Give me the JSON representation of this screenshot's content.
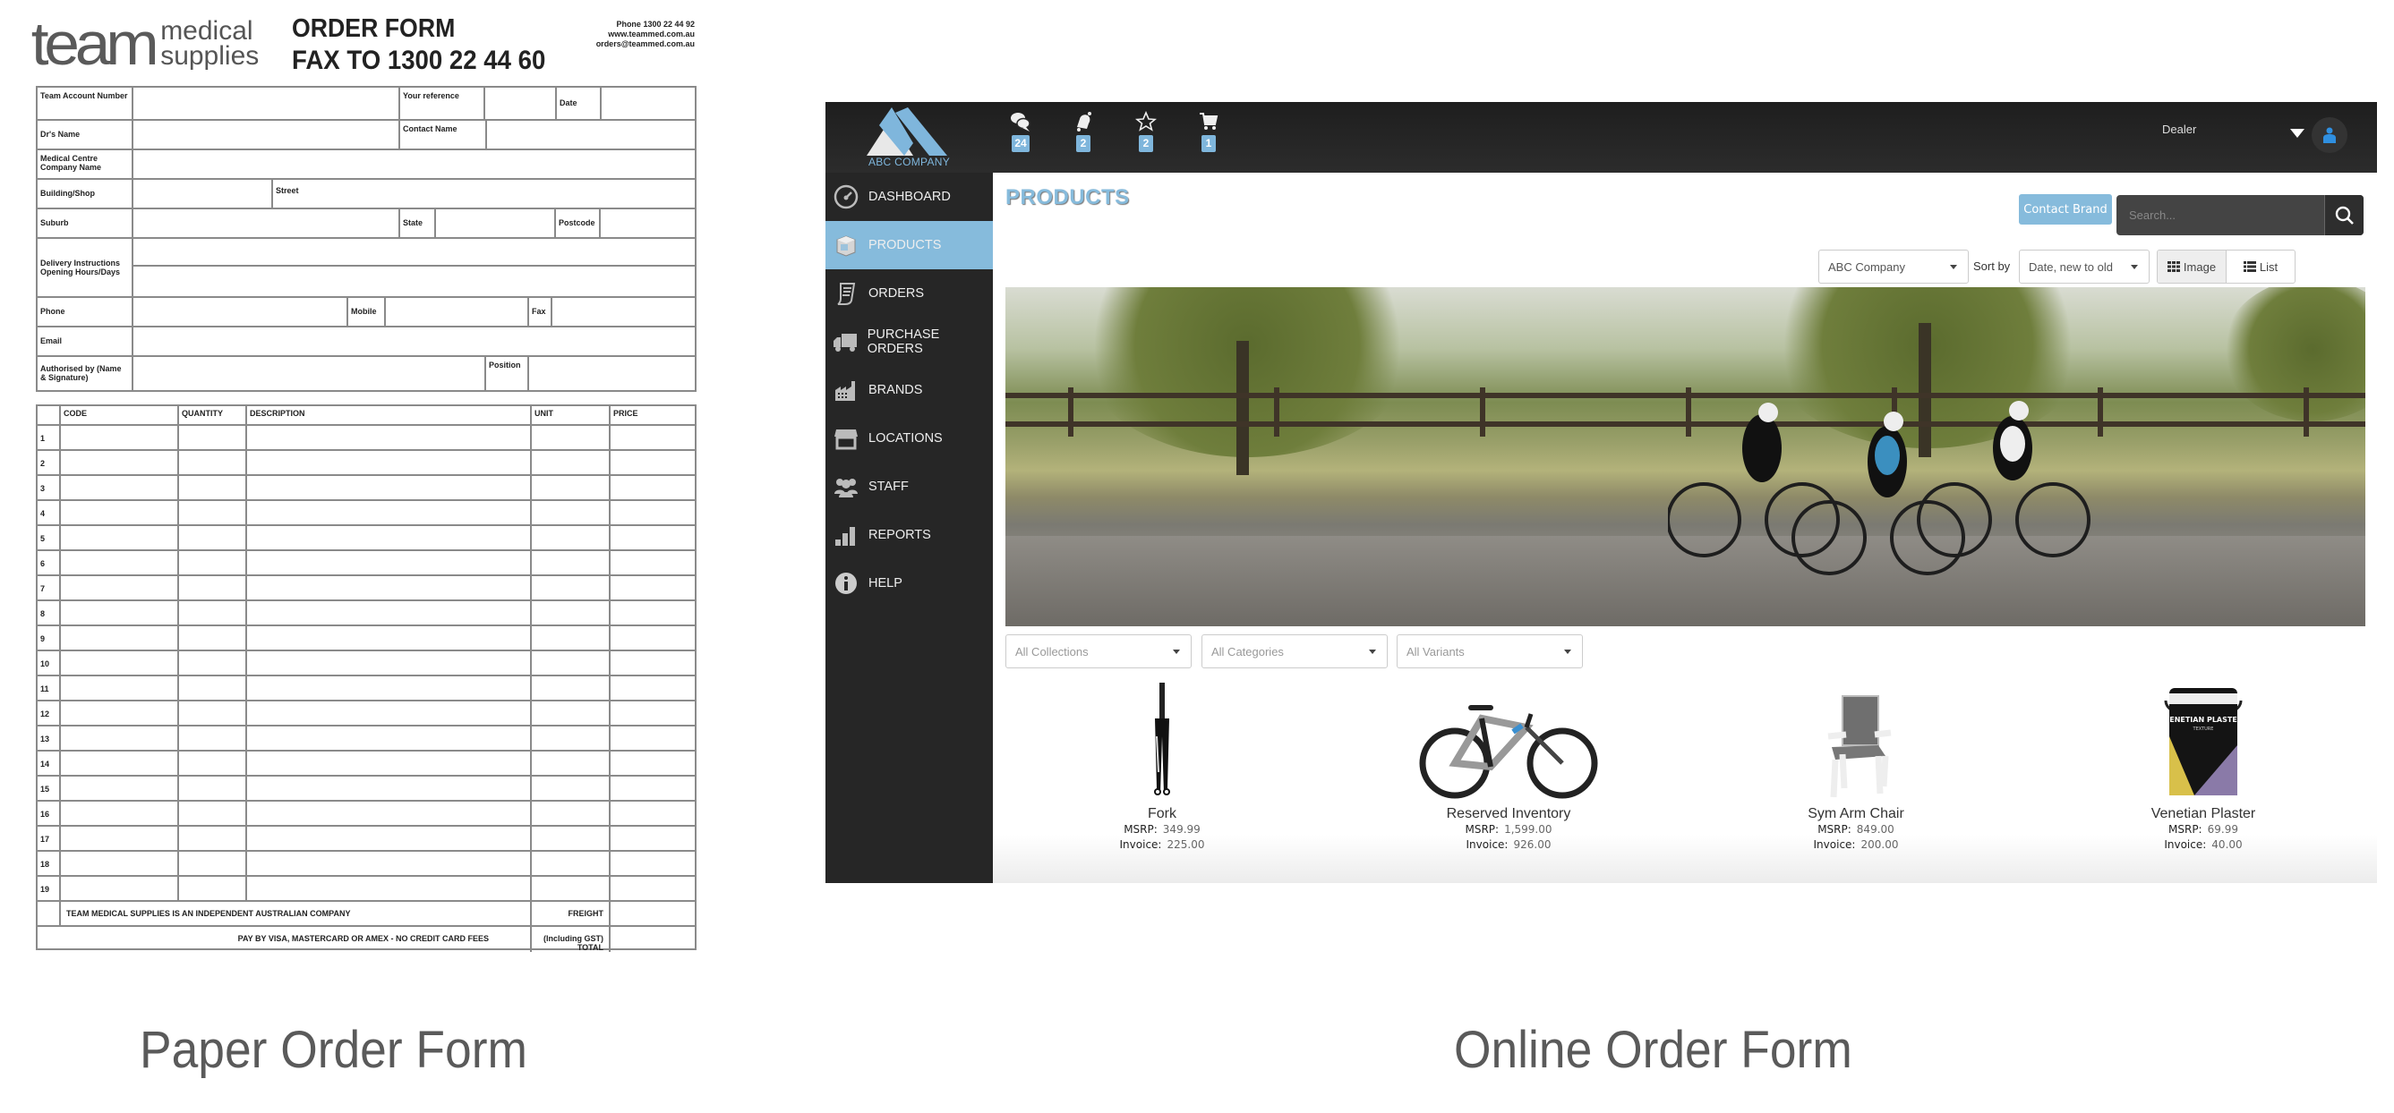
{
  "paper_form": {
    "logo": {
      "main": "team",
      "line1": "medical",
      "line2": "supplies"
    },
    "title_line1": "ORDER FORM",
    "title_line2": "FAX TO 1300 22 44 60",
    "contact": [
      "Phone 1300 22 44 92",
      "www.teammed.com.au",
      "orders@teammed.com.au"
    ],
    "fields": {
      "account_number": "Team Account Number",
      "your_reference": "Your reference",
      "date": "Date",
      "drs_name": "Dr's Name",
      "contact_name": "Contact Name",
      "company_name": "Medical Centre Company Name",
      "building": "Building/Shop",
      "street": "Street",
      "suburb": "Suburb",
      "state": "State",
      "postcode": "Postcode",
      "delivery": "Delivery Instructions Opening Hours/Days",
      "phone": "Phone",
      "mobile": "Mobile",
      "fax": "Fax",
      "email": "Email",
      "authorised": "Authorised by (Name & Signature)",
      "position": "Position"
    },
    "table": {
      "headers": [
        "",
        "CODE",
        "QUANTITY",
        "DESCRIPTION",
        "UNIT",
        "PRICE"
      ],
      "rows": [
        "1",
        "2",
        "3",
        "4",
        "5",
        "6",
        "7",
        "8",
        "9",
        "10",
        "11",
        "12",
        "13",
        "14",
        "15",
        "16",
        "17",
        "18",
        "19"
      ],
      "footer_note": "TEAM MEDICAL SUPPLIES IS AN INDEPENDENT AUSTRALIAN COMPANY",
      "freight_label": "FREIGHT",
      "payment_note": "PAY BY VISA, MASTERCARD OR AMEX - NO CREDIT CARD FEES",
      "total_label": "(Including GST) TOTAL"
    }
  },
  "captions": {
    "paper": "Paper Order Form",
    "online": "Online Order Form"
  },
  "app": {
    "brand_name": "ABC COMPANY",
    "accent": "#86bbdc",
    "nav_icons": [
      {
        "icon": "chat-bubbles-icon",
        "badge": "24"
      },
      {
        "icon": "bell-icon",
        "badge": "2"
      },
      {
        "icon": "star-icon",
        "badge": "2"
      },
      {
        "icon": "cart-icon",
        "badge": "1"
      }
    ],
    "user_role": "Dealer",
    "sidebar": [
      {
        "label": "DASHBOARD",
        "icon": "dashboard-gauge-icon",
        "active": false
      },
      {
        "label": "PRODUCTS",
        "icon": "box-icon",
        "active": true
      },
      {
        "label": "ORDERS",
        "icon": "receipt-icon",
        "active": false
      },
      {
        "label": "PURCHASE ORDERS",
        "icon": "truck-icon",
        "active": false
      },
      {
        "label": "BRANDS",
        "icon": "factory-icon",
        "active": false
      },
      {
        "label": "LOCATIONS",
        "icon": "storefront-icon",
        "active": false
      },
      {
        "label": "STAFF",
        "icon": "people-icon",
        "active": false
      },
      {
        "label": "REPORTS",
        "icon": "bar-chart-icon",
        "active": false
      },
      {
        "label": "HELP",
        "icon": "info-icon",
        "active": false
      }
    ],
    "page_title": "PRODUCTS",
    "contact_brand": "Contact Brand",
    "search_placeholder": "Search...",
    "company_select": "ABC Company",
    "sort_label": "Sort by",
    "sort_select": "Date, new to old",
    "view_image": "Image",
    "view_list": "List",
    "filters": {
      "collections": "All Collections",
      "categories": "All Categories",
      "variants": "All Variants"
    },
    "msrp_label": "MSRP:",
    "invoice_label": "Invoice:",
    "products": [
      {
        "name": "Fork",
        "msrp": "349.99",
        "invoice": "225.00"
      },
      {
        "name": "Reserved Inventory",
        "msrp": "1,599.00",
        "invoice": "926.00"
      },
      {
        "name": "Sym Arm Chair",
        "msrp": "849.00",
        "invoice": "200.00"
      },
      {
        "name": "Venetian Plaster",
        "msrp": "69.99",
        "invoice": "40.00"
      }
    ]
  }
}
